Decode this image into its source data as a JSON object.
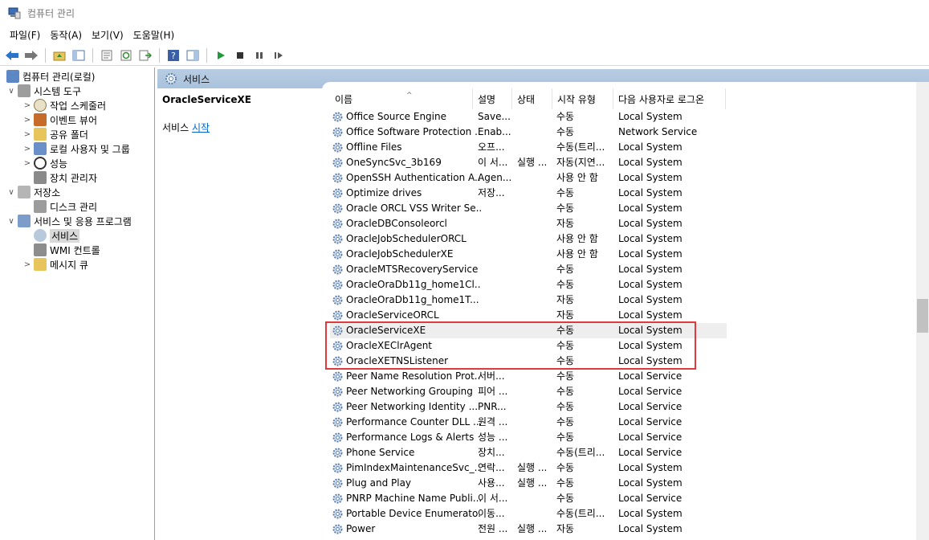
{
  "window": {
    "title": "컴퓨터 관리"
  },
  "menu": [
    "파일(F)",
    "동작(A)",
    "보기(V)",
    "도움말(H)"
  ],
  "toolbar": {
    "icons": [
      "back-icon",
      "forward-icon",
      "up-folder-icon",
      "show-hide-tree-icon",
      "properties-icon",
      "refresh-icon",
      "export-list-icon",
      "help-icon",
      "view-icon",
      "start-service-icon",
      "stop-service-icon",
      "pause-service-icon",
      "resume-service-icon"
    ]
  },
  "tree": [
    {
      "label": "컴퓨터 관리(로컬)",
      "arrow": "",
      "icon": "computer-management-icon",
      "depth": 0
    },
    {
      "label": "시스템 도구",
      "arrow": "∨",
      "icon": "system-tools-icon",
      "depth": 1
    },
    {
      "label": "작업 스케줄러",
      "arrow": ">",
      "icon": "task-scheduler-icon",
      "depth": 2
    },
    {
      "label": "이벤트 뷰어",
      "arrow": ">",
      "icon": "event-viewer-icon",
      "depth": 2
    },
    {
      "label": "공유 폴더",
      "arrow": ">",
      "icon": "shared-folders-icon",
      "depth": 2
    },
    {
      "label": "로컬 사용자 및 그룹",
      "arrow": ">",
      "icon": "local-users-icon",
      "depth": 2
    },
    {
      "label": "성능",
      "arrow": ">",
      "icon": "performance-icon",
      "depth": 2
    },
    {
      "label": "장치 관리자",
      "arrow": "",
      "icon": "device-manager-icon",
      "depth": 2
    },
    {
      "label": "저장소",
      "arrow": "∨",
      "icon": "storage-icon",
      "depth": 1
    },
    {
      "label": "디스크 관리",
      "arrow": "",
      "icon": "disk-management-icon",
      "depth": 2
    },
    {
      "label": "서비스 및 응용 프로그램",
      "arrow": "∨",
      "icon": "services-apps-icon",
      "depth": 1
    },
    {
      "label": "서비스",
      "arrow": "",
      "icon": "services-icon",
      "depth": 2,
      "selected": true
    },
    {
      "label": "WMI 컨트롤",
      "arrow": "",
      "icon": "wmi-control-icon",
      "depth": 2
    },
    {
      "label": "메시지 큐",
      "arrow": ">",
      "icon": "message-queue-icon",
      "depth": 2
    }
  ],
  "header": {
    "title": "서비스"
  },
  "description": {
    "service_name": "OracleServiceXE",
    "prefix": "서비스",
    "link": "시작"
  },
  "columns": [
    "이름",
    "설명",
    "상태",
    "시작 유형",
    "다음 사용자로 로그온"
  ],
  "rows": [
    {
      "name": "Office  Source Engine",
      "desc": "Save...",
      "status": "",
      "startup": "수동",
      "logon": "Local System"
    },
    {
      "name": "Office Software Protection ...",
      "desc": "Enab...",
      "status": "",
      "startup": "수동",
      "logon": "Network Service"
    },
    {
      "name": "Offline Files",
      "desc": "오프...",
      "status": "",
      "startup": "수동(트리...",
      "logon": "Local System"
    },
    {
      "name": "OneSyncSvc_3b169",
      "desc": "이 서...",
      "status": "실행 ...",
      "startup": "자동(지연...",
      "logon": "Local System"
    },
    {
      "name": "OpenSSH Authentication A...",
      "desc": "Agen...",
      "status": "",
      "startup": "사용 안 함",
      "logon": "Local System"
    },
    {
      "name": "Optimize drives",
      "desc": "저장...",
      "status": "",
      "startup": "수동",
      "logon": "Local System"
    },
    {
      "name": "Oracle ORCL VSS Writer Se...",
      "desc": "",
      "status": "",
      "startup": "수동",
      "logon": "Local System"
    },
    {
      "name": "OracleDBConsoleorcl",
      "desc": "",
      "status": "",
      "startup": "자동",
      "logon": "Local System"
    },
    {
      "name": "OracleJobSchedulerORCL",
      "desc": "",
      "status": "",
      "startup": "사용 안 함",
      "logon": "Local System"
    },
    {
      "name": "OracleJobSchedulerXE",
      "desc": "",
      "status": "",
      "startup": "사용 안 함",
      "logon": "Local System"
    },
    {
      "name": "OracleMTSRecoveryService",
      "desc": "",
      "status": "",
      "startup": "수동",
      "logon": "Local System"
    },
    {
      "name": "OracleOraDb11g_home1Cl...",
      "desc": "",
      "status": "",
      "startup": "수동",
      "logon": "Local System"
    },
    {
      "name": "OracleOraDb11g_home1T...",
      "desc": "",
      "status": "",
      "startup": "자동",
      "logon": "Local System"
    },
    {
      "name": "OracleServiceORCL",
      "desc": "",
      "status": "",
      "startup": "자동",
      "logon": "Local System"
    },
    {
      "name": "OracleServiceXE",
      "desc": "",
      "status": "",
      "startup": "수동",
      "logon": "Local System",
      "selected": true
    },
    {
      "name": "OracleXEClrAgent",
      "desc": "",
      "status": "",
      "startup": "수동",
      "logon": "Local System"
    },
    {
      "name": "OracleXETNSListener",
      "desc": "",
      "status": "",
      "startup": "수동",
      "logon": "Local System"
    },
    {
      "name": "Peer Name Resolution Prot...",
      "desc": "서버...",
      "status": "",
      "startup": "수동",
      "logon": "Local Service"
    },
    {
      "name": "Peer Networking Grouping",
      "desc": "피어 ...",
      "status": "",
      "startup": "수동",
      "logon": "Local Service"
    },
    {
      "name": "Peer Networking Identity ...",
      "desc": "PNR...",
      "status": "",
      "startup": "수동",
      "logon": "Local Service"
    },
    {
      "name": "Performance Counter DLL ...",
      "desc": "원격 ...",
      "status": "",
      "startup": "수동",
      "logon": "Local Service"
    },
    {
      "name": "Performance Logs & Alerts",
      "desc": "성능 ...",
      "status": "",
      "startup": "수동",
      "logon": "Local Service"
    },
    {
      "name": "Phone Service",
      "desc": "장치...",
      "status": "",
      "startup": "수동(트리...",
      "logon": "Local Service"
    },
    {
      "name": "PimIndexMaintenanceSvc_...",
      "desc": "연락...",
      "status": "실행 ...",
      "startup": "수동",
      "logon": "Local System"
    },
    {
      "name": "Plug and Play",
      "desc": "사용...",
      "status": "실행 ...",
      "startup": "수동",
      "logon": "Local System"
    },
    {
      "name": "PNRP Machine Name Publi...",
      "desc": "이 서...",
      "status": "",
      "startup": "수동",
      "logon": "Local Service"
    },
    {
      "name": "Portable Device Enumerato...",
      "desc": "이동...",
      "status": "",
      "startup": "수동(트리...",
      "logon": "Local System"
    },
    {
      "name": "Power",
      "desc": "전원 ...",
      "status": "실행 ...",
      "startup": "자동",
      "logon": "Local System"
    }
  ]
}
